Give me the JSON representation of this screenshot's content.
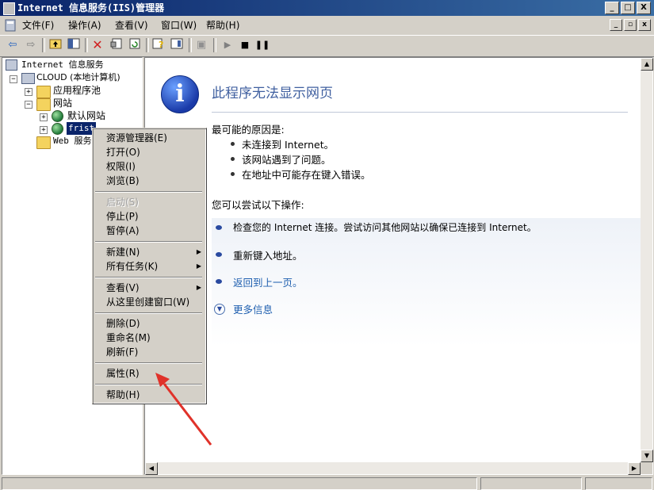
{
  "window": {
    "title": "Internet 信息服务(IIS)管理器",
    "minimize": "_",
    "restore": "□",
    "close": "X"
  },
  "menubar": {
    "items": [
      "文件(F)",
      "操作(A)",
      "查看(V)",
      "窗口(W)",
      "帮助(H)"
    ],
    "mdi_min": "_",
    "mdi_restore": "▫",
    "mdi_close": "x"
  },
  "toolbar": {
    "icons": [
      "back-icon",
      "forward-icon",
      "up-folder-icon",
      "show-tree-icon",
      "delete-icon",
      "properties-icon",
      "refresh-icon",
      "help-icon",
      "console-icon",
      "computer-icon",
      "play-icon",
      "stop-icon",
      "pause-icon"
    ]
  },
  "tree": {
    "root": "Internet 信息服务",
    "computer": "CLOUD (本地计算机)",
    "app_pools": "应用程序池",
    "websites": "网站",
    "default_site": "默认网站",
    "selected_site": "frist",
    "web_ext": "Web 服务扩展"
  },
  "context_menu": {
    "explorer": "资源管理器(E)",
    "open": "打开(O)",
    "permissions": "权限(I)",
    "browse": "浏览(B)",
    "start": "启动(S)",
    "stop": "停止(P)",
    "pause": "暂停(A)",
    "new": "新建(N)",
    "all_tasks": "所有任务(K)",
    "view": "查看(V)",
    "new_window": "从这里创建窗口(W)",
    "delete": "删除(D)",
    "rename": "重命名(M)",
    "refresh": "刷新(F)",
    "properties": "属性(R)",
    "help": "帮助(H)"
  },
  "error_page": {
    "title": "此程序无法显示网页",
    "causes_heading": "最可能的原因是:",
    "causes": [
      "未连接到 Internet。",
      "该网站遇到了问题。",
      "在地址中可能存在键入错误。"
    ],
    "actions_heading": "您可以尝试以下操作:",
    "actions": [
      "检查您的 Internet 连接。尝试访问其他网站以确保已连接到 Internet。",
      "重新键入地址。"
    ],
    "back_link": "返回到上一页。",
    "more_info": "更多信息"
  },
  "colors": {
    "titlebar": "#0a246a",
    "selection": "#0a246a",
    "link": "#2060b0",
    "heading": "#4060a0",
    "annotation": "#e0322a"
  }
}
